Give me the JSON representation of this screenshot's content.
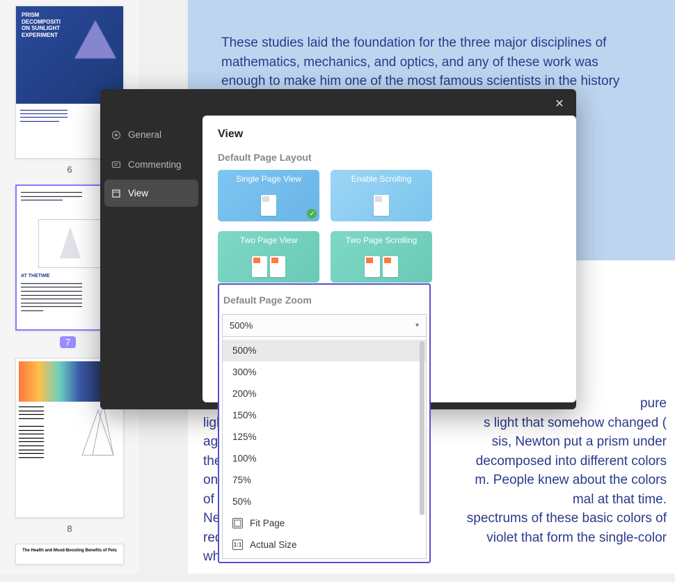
{
  "thumbnails": {
    "t6": {
      "title": "PRISM DECOMPOSITI ON SUNLIGHT EXPERIMENT",
      "page_num": "6"
    },
    "t7": {
      "heading": "AT THETIME",
      "page_num": "7"
    },
    "t8": {
      "page_num": "8"
    },
    "t9": {
      "title": "The Health and Mood-Boosting Benefits of Pets"
    }
  },
  "document_text": {
    "blue_block": "These studies laid the foundation for the three major disciplines of mathematics, mechanics, and optics, and any of these work was enough to make him one of the most famous scientists in the history",
    "body_p2_frag_1": "pure",
    "body_p2_frag_2": "light",
    "body_p2_frag_3": "s light that somehow changed (",
    "body_p2_frag_4": "aga",
    "body_p2_frag_5": "sis, Newton put a prism under",
    "body_p2_frag_6": "the",
    "body_p2_frag_7": "decomposed into different colors",
    "body_p2_frag_8": "on t",
    "body_p2_frag_9": "m. People knew about the colors",
    "body_p2_frag_10": "of th",
    "body_p2_frag_11": "mal at that time.",
    "body_p2_frag_12": "New",
    "body_p2_frag_13": "spectrums of these basic colors of",
    "body_p2_frag_14": "red,",
    "body_p2_frag_15": "violet that form the single-color",
    "body_p2_frag_16": "whi"
  },
  "modal": {
    "sidebar": {
      "general": "General",
      "commenting": "Commenting",
      "view": "View"
    },
    "title": "View",
    "layout": {
      "label": "Default Page Layout",
      "single": "Single Page View",
      "scroll": "Enable Scrolling",
      "two": "Two Page View",
      "two_scroll": "Two Page Scrolling"
    },
    "zoom": {
      "label": "Default Page Zoom",
      "selected": "500%",
      "options": [
        "500%",
        "300%",
        "200%",
        "150%",
        "125%",
        "100%",
        "75%",
        "50%"
      ],
      "fit_page": "Fit Page",
      "actual_size": "Actual Size",
      "actual_size_icon": "1:1"
    }
  }
}
